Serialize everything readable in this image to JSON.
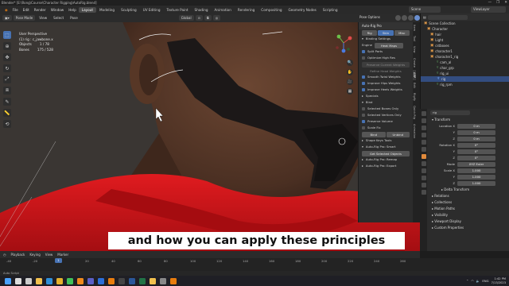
{
  "window": {
    "title": "Blender* [E:\\Rong\\Course\\Character Rigging\\AutoRig.blend]",
    "controls": [
      "—",
      "❐",
      "✕"
    ]
  },
  "menubar": {
    "items": [
      "File",
      "Edit",
      "Render",
      "Window",
      "Help"
    ],
    "workspaces": [
      "Layout",
      "Modeling",
      "Sculpting",
      "UV Editing",
      "Texture Paint",
      "Shading",
      "Animation",
      "Rendering",
      "Compositing",
      "Geometry Nodes",
      "Scripting"
    ],
    "active_workspace": "Layout",
    "scene": "Scene",
    "view_layer": "ViewLayer"
  },
  "viewport_header": {
    "mode": "Pose Mode",
    "items": [
      "View",
      "Select",
      "Pose"
    ],
    "orientation": "Global",
    "pivot_label": "Pose Options"
  },
  "viewport": {
    "perspective": "User Perspective",
    "object": "(1) rig : c_jawbone.x",
    "stats": [
      {
        "label": "Objects",
        "value": "1 / 78"
      },
      {
        "label": "Bones",
        "value": "175 / 528"
      }
    ],
    "colors": {
      "skin": "#4a2f22",
      "shirt": "#d8141a",
      "beard": "#1c1818",
      "bg": "#3b2f29"
    }
  },
  "npanel": {
    "panel_title": "Auto-Rig Pro",
    "tabs": [
      "Rig",
      "Skin",
      "Misc"
    ],
    "active_tab": "Skin",
    "binding_section": "Binding Settings",
    "engine_label": "Engine",
    "engine_value": "Heat Maps",
    "options": [
      {
        "label": "Split Parts",
        "checked": true
      },
      {
        "label": "Optimize High Res",
        "checked": false
      }
    ],
    "dim_button_1": "Preserve Current Weights",
    "dim_button_2": "Refine Head Weights",
    "options2": [
      {
        "label": "Smooth Twist Weights",
        "checked": true
      },
      {
        "label": "Improve Hips Weights",
        "checked": true
      },
      {
        "label": "Improve Heels Weights",
        "checked": true
      }
    ],
    "special_section": "Specials",
    "bind_section": "Bind",
    "options3": [
      {
        "label": "Selected Bones Only",
        "checked": false
      },
      {
        "label": "Selected Vertices Only",
        "checked": false
      },
      {
        "label": "Preserve Volume",
        "checked": true
      },
      {
        "label": "Scale Fix",
        "checked": false
      }
    ],
    "bind_button": "Bind",
    "unbind_button": "Unbind",
    "shape_keys": "Shape Keys Tools",
    "smart_section": "Auto-Rig Pro: Smart",
    "smart_button": "Get Selected Objects",
    "remap_section": "Auto-Rig Pro: Remap",
    "export_section": "Auto-Rig Pro: Export",
    "side_tabs": [
      "Item",
      "Tool",
      "View",
      "Create",
      "ARP",
      "Edit",
      "Rigify",
      "Quick Rig",
      "Animation"
    ]
  },
  "subtitle": "and how you can apply these principles",
  "outliner": {
    "title": "Scene Collection",
    "rows": [
      {
        "label": "Character",
        "icon": "collection",
        "depth": 1
      },
      {
        "label": "hair",
        "icon": "collection",
        "depth": 2
      },
      {
        "label": "Light",
        "icon": "collection",
        "depth": 2
      },
      {
        "label": "cstboxes",
        "icon": "collection",
        "depth": 2
      },
      {
        "label": "character1",
        "icon": "collection",
        "depth": 2
      },
      {
        "label": "character1_rig",
        "icon": "collection",
        "depth": 2
      },
      {
        "label": "cam_al",
        "icon": "object",
        "depth": 3
      },
      {
        "label": "char_grp",
        "icon": "object",
        "depth": 3
      },
      {
        "label": "rig_ui",
        "icon": "object",
        "depth": 3
      },
      {
        "label": "rig",
        "icon": "armature",
        "depth": 3,
        "selected": true
      },
      {
        "label": "rig_rpm",
        "icon": "object",
        "depth": 3
      }
    ]
  },
  "properties": {
    "search_value": "rig",
    "transform_title": "Transform",
    "location_label": "Location X",
    "location": [
      "0 m",
      "0 m",
      "0 m"
    ],
    "rotation_label": "Rotation X",
    "rotation": [
      "0°",
      "0°",
      "0°"
    ],
    "mode_label": "Mode",
    "mode_value": "XYZ Euler",
    "scale_label": "Scale X",
    "scale": [
      "1.000",
      "1.000",
      "1.000"
    ],
    "axis_y": "Y",
    "axis_z": "Z",
    "sections": [
      "Delta Transform",
      "Relations",
      "Collections",
      "Motion Paths",
      "Visibility",
      "Viewport Display",
      "Custom Properties"
    ]
  },
  "timeline": {
    "items": [
      "Playback",
      "Keying",
      "View",
      "Marker"
    ],
    "current_frame": "1",
    "ticks": [
      "-40",
      "-20",
      "0",
      "20",
      "40",
      "60",
      "80",
      "100",
      "120",
      "140",
      "160",
      "180",
      "200",
      "220",
      "240",
      "260"
    ]
  },
  "statusbar": {
    "text": "Auto Script"
  },
  "taskbar": {
    "icons": [
      "start",
      "search",
      "taskview",
      "explorer",
      "edge",
      "chrome",
      "whatsapp",
      "vlc",
      "teams",
      "photoshop",
      "blender",
      "obs",
      "word",
      "excel",
      "folder",
      "settings",
      "blender2"
    ],
    "clock_time": "1:42 PM",
    "clock_date": "7/13/2023",
    "lang": "ENG"
  }
}
